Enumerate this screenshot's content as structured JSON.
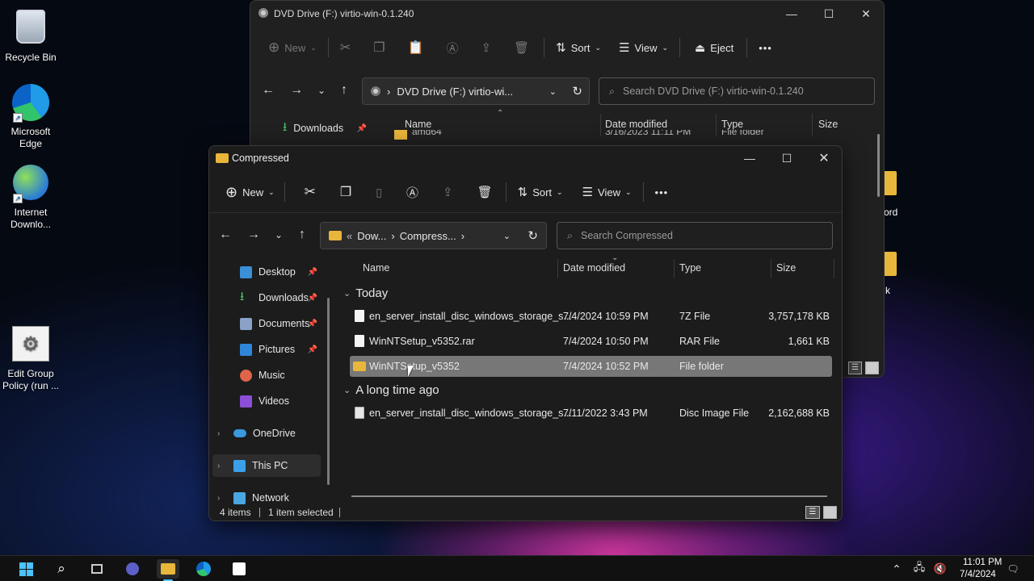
{
  "desktop": {
    "icons": [
      {
        "label": "Recycle Bin"
      },
      {
        "label": "Microsoft Edge"
      },
      {
        "label": "Internet Downlo..."
      },
      {
        "label": "Edit Group Policy (run ..."
      }
    ],
    "partial_labels": [
      "ord",
      "k"
    ]
  },
  "back_window": {
    "title": "DVD Drive (F:) virtio-win-0.1.240",
    "toolbar": {
      "new": "New",
      "sort": "Sort",
      "view": "View",
      "eject": "Eject",
      "more": "•••"
    },
    "address": "DVD Drive (F:) virtio-wi...",
    "search_placeholder": "Search DVD Drive (F:) virtio-win-0.1.240",
    "sidebar_item": "Downloads",
    "columns": {
      "name": "Name",
      "date": "Date modified",
      "type": "Type",
      "size": "Size"
    },
    "peek_row": {
      "name": "amd64",
      "date": "3/16/2023 11:11 PM",
      "type": "File folder"
    }
  },
  "front_window": {
    "title": "Compressed",
    "toolbar": {
      "new": "New",
      "sort": "Sort",
      "view": "View",
      "more": "•••"
    },
    "breadcrumb": {
      "overflow": "«",
      "part1": "Dow...",
      "part2": "Compress...",
      "chevron": "›"
    },
    "search_placeholder": "Search Compressed",
    "sidebar": [
      {
        "label": "Desktop",
        "pinned": true
      },
      {
        "label": "Downloads",
        "pinned": true
      },
      {
        "label": "Documents",
        "pinned": true
      },
      {
        "label": "Pictures",
        "pinned": true
      },
      {
        "label": "Music",
        "pinned": false
      },
      {
        "label": "Videos",
        "pinned": false
      },
      {
        "label": "OneDrive",
        "pinned": false
      },
      {
        "label": "This PC",
        "pinned": false
      },
      {
        "label": "Network",
        "pinned": false
      }
    ],
    "columns": {
      "name": "Name",
      "date": "Date modified",
      "type": "Type",
      "size": "Size"
    },
    "groups": [
      {
        "label": "Today",
        "rows": [
          {
            "name": "en_server_install_disc_windows_storage_s...",
            "date": "7/4/2024 10:59 PM",
            "type": "7Z File",
            "size": "3,757,178 KB",
            "icon": "file-icon"
          },
          {
            "name": "WinNTSetup_v5352.rar",
            "date": "7/4/2024 10:50 PM",
            "type": "RAR File",
            "size": "1,661 KB",
            "icon": "file-icon"
          },
          {
            "name": "WinNTSetup_v5352",
            "date": "7/4/2024 10:52 PM",
            "type": "File folder",
            "size": "",
            "icon": "folder-icon",
            "selected": true
          }
        ]
      },
      {
        "label": "A long time ago",
        "rows": [
          {
            "name": "en_server_install_disc_windows_storage_s...",
            "date": "7/11/2022 3:43 PM",
            "type": "Disc Image File",
            "size": "2,162,688 KB",
            "icon": "disc-image-icon"
          }
        ]
      }
    ],
    "status": {
      "items": "4 items",
      "selected": "1 item selected"
    }
  },
  "taskbar": {
    "time": "11:01 PM",
    "date": "7/4/2024"
  },
  "colors": {
    "accent": "#4cc2ff",
    "selection": "#777777",
    "window_bg": "#1c1c1c",
    "folder": "#e8b63a"
  }
}
